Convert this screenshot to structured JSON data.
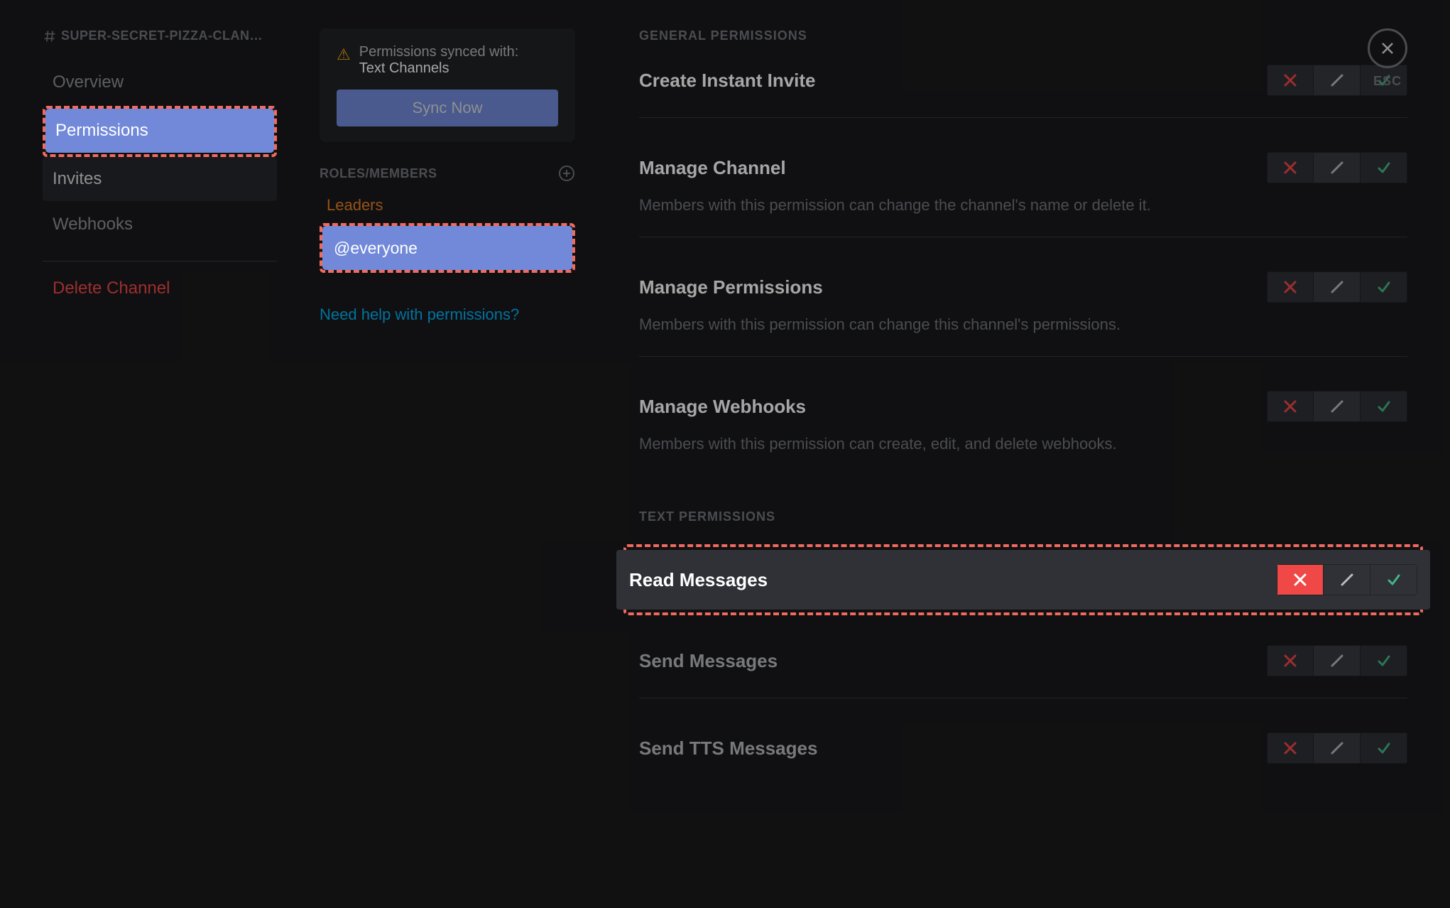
{
  "sidebar": {
    "channel_prefix_icon": "hash",
    "channel_name": "SUPER-SECRET-PIZZA-CLAN…",
    "items": [
      {
        "label": "Overview",
        "selected": false,
        "hovered": false
      },
      {
        "label": "Permissions",
        "selected": true,
        "hovered": false
      },
      {
        "label": "Invites",
        "selected": false,
        "hovered": true
      },
      {
        "label": "Webhooks",
        "selected": false,
        "hovered": false
      }
    ],
    "delete_label": "Delete Channel"
  },
  "sync_card": {
    "warning_icon": "warning",
    "line1": "Permissions synced with:",
    "line2": "Text Channels",
    "button_label": "Sync Now"
  },
  "roles_panel": {
    "header": "ROLES/MEMBERS",
    "plus_icon": "plus-circle",
    "items": [
      {
        "label": "Leaders",
        "color": "#e67e22",
        "selected": false
      },
      {
        "label": "@everyone",
        "color": "#ffffff",
        "selected": true
      }
    ],
    "help_link": "Need help with permissions?"
  },
  "main": {
    "sections": [
      {
        "header": "GENERAL PERMISSIONS",
        "rows": [
          {
            "title": "Create Instant Invite",
            "state": "pass"
          },
          {
            "title": "Manage Channel",
            "desc": "Members with this permission can change the channel's name or delete it.",
            "state": "pass"
          },
          {
            "title": "Manage Permissions",
            "desc": "Members with this permission can change this channel's permissions.",
            "state": "pass"
          },
          {
            "title": "Manage Webhooks",
            "desc": "Members with this permission can create, edit, and delete webhooks.",
            "state": "pass"
          }
        ]
      },
      {
        "header": "TEXT PERMISSIONS",
        "rows": [
          {
            "title": "Read Messages",
            "state": "deny",
            "highlighted": true
          },
          {
            "title": "Send Messages",
            "state": "pass"
          },
          {
            "title": "Send TTS Messages",
            "state": "pass"
          }
        ]
      }
    ]
  },
  "close": {
    "label": "ESC",
    "icon": "close"
  }
}
